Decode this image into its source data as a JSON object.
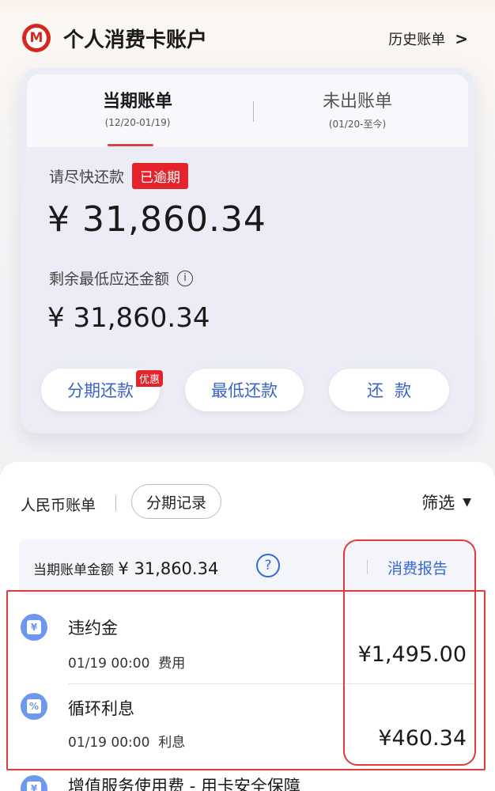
{
  "header": {
    "title": "个人消费卡账户",
    "history_label": "历史账单",
    "logo_letter": "M"
  },
  "bill_card": {
    "tabs": [
      {
        "label": "当期账单",
        "dates": "(12/20-01/19)",
        "active": true
      },
      {
        "label": "未出账单",
        "dates": "(01/20-至今)",
        "active": false
      }
    ],
    "urge_text": "请尽快还款",
    "overdue_badge": "已逾期",
    "amount_due": "¥ 31,860.34",
    "min_label": "剩余最低应还金额",
    "min_amount": "¥ 31,860.34",
    "buttons": {
      "installment": "分期还款",
      "promo_badge": "优惠",
      "minimum": "最低还款",
      "repay": "还款"
    }
  },
  "statement": {
    "currency_label": "人民币账单",
    "installment_records": "分期记录",
    "filter_label": "筛选",
    "summary_label": "当期账单金额",
    "summary_amount": "¥ 31,860.34",
    "report_link": "消费报告",
    "transactions": [
      {
        "icon": "yen-icon",
        "glyph": "¥",
        "name": "违约金",
        "time": "01/19 00:00",
        "type": "费用",
        "amount": "¥1,495.00"
      },
      {
        "icon": "percent-icon",
        "glyph": "%",
        "name": "循环利息",
        "time": "01/19 00:00",
        "type": "利息",
        "amount": "¥460.34"
      },
      {
        "icon": "yen-icon",
        "glyph": "¥",
        "name": "增值服务使用费 - 用卡安全保障"
      }
    ]
  },
  "colors": {
    "brand_red": "#d6271f",
    "overdue_red": "#e5232b",
    "link_blue": "#3868d4",
    "annotation_red": "#e03a3a"
  }
}
